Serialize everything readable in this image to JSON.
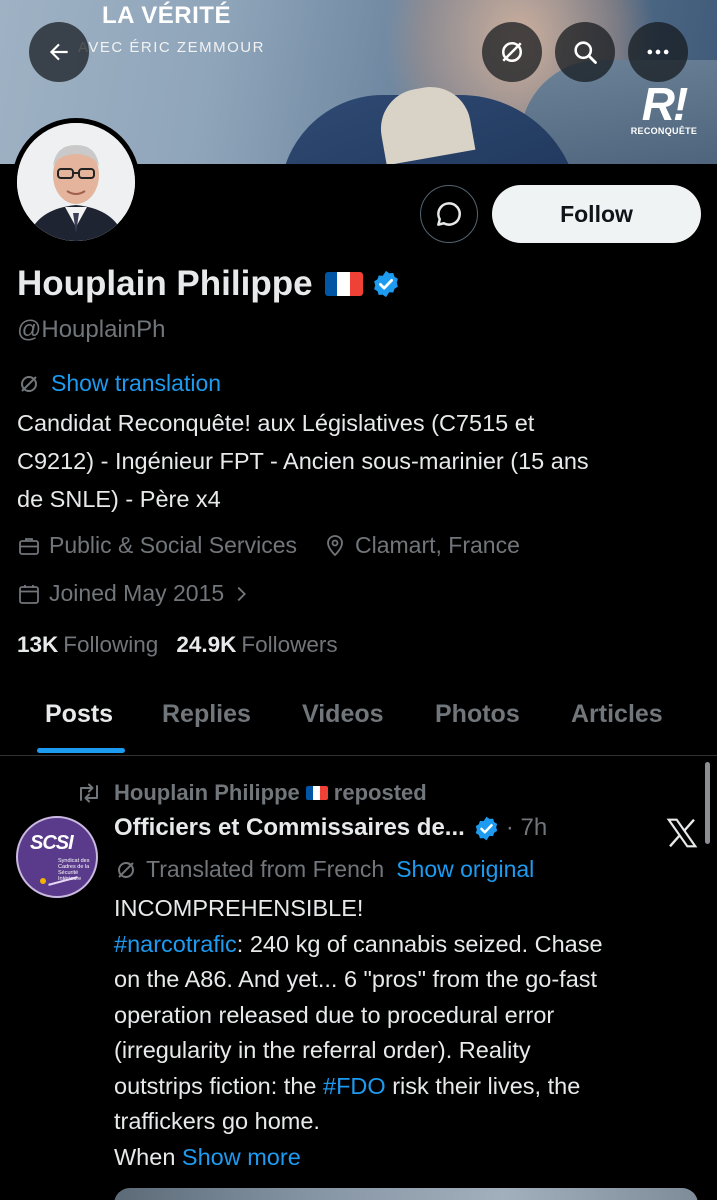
{
  "banner": {
    "title": "LA VÉRITÉ",
    "subtitle": "AVEC ÉRIC ZEMMOUR",
    "logo_mark": "R!",
    "logo_word": "RECONQUÊTE"
  },
  "profile": {
    "name": "Houplain Philippe",
    "handle": "@HouplainPh",
    "show_translation": "Show translation",
    "bio_line1": "Candidat Reconquête! aux Législatives (C7515 et",
    "bio_line2": "C9212) - Ingénieur FPT - Ancien sous-marinier (15 ans",
    "bio_line3": "de SNLE) - Père x4",
    "category": "Public & Social Services",
    "location": "Clamart, France",
    "joined": "Joined May 2015",
    "following_count": "13K",
    "following_label": "Following",
    "followers_count": "24.9K",
    "followers_label": "Followers",
    "follow_button": "Follow"
  },
  "tabs": [
    "Posts",
    "Replies",
    "Videos",
    "Photos",
    "Articles"
  ],
  "active_tab": "Posts",
  "post": {
    "reposter": "Houplain Philippe",
    "reposted_label": "reposted",
    "account_name": "Officiers et Commissaires de...",
    "time": "· 7h",
    "avatar_text": "SCSI",
    "avatar_small": "Syndicat des Cadres de la Sécurité Intérieure",
    "translated_label": "Translated from French",
    "show_original": "Show original",
    "line1": "INCOMPREHENSIBLE!",
    "hashtag1": "#narcotrafic",
    "line2_rest": ": 240 kg of cannabis seized. Chase",
    "line3": "on the A86. And yet... 6 \"pros\" from the go-fast",
    "line4": "operation released due to procedural error",
    "line5": "(irregularity in the referral order). Reality",
    "line6_start": "outstrips fiction: the ",
    "hashtag2": "#FDO",
    "line6_rest": " risk their lives, the",
    "line7": "traffickers go home.",
    "line8_start": "When ",
    "show_more": "Show more"
  },
  "colors": {
    "accent": "#1d9bf0",
    "muted": "#71767b",
    "text": "#e7e9ea",
    "background": "#000000"
  },
  "icons": [
    "back-arrow-icon",
    "translate-icon",
    "search-icon",
    "more-icon",
    "message-icon",
    "verified-badge-icon",
    "briefcase-icon",
    "location-pin-icon",
    "calendar-icon",
    "chevron-right-icon",
    "repost-icon",
    "x-logo-icon"
  ]
}
